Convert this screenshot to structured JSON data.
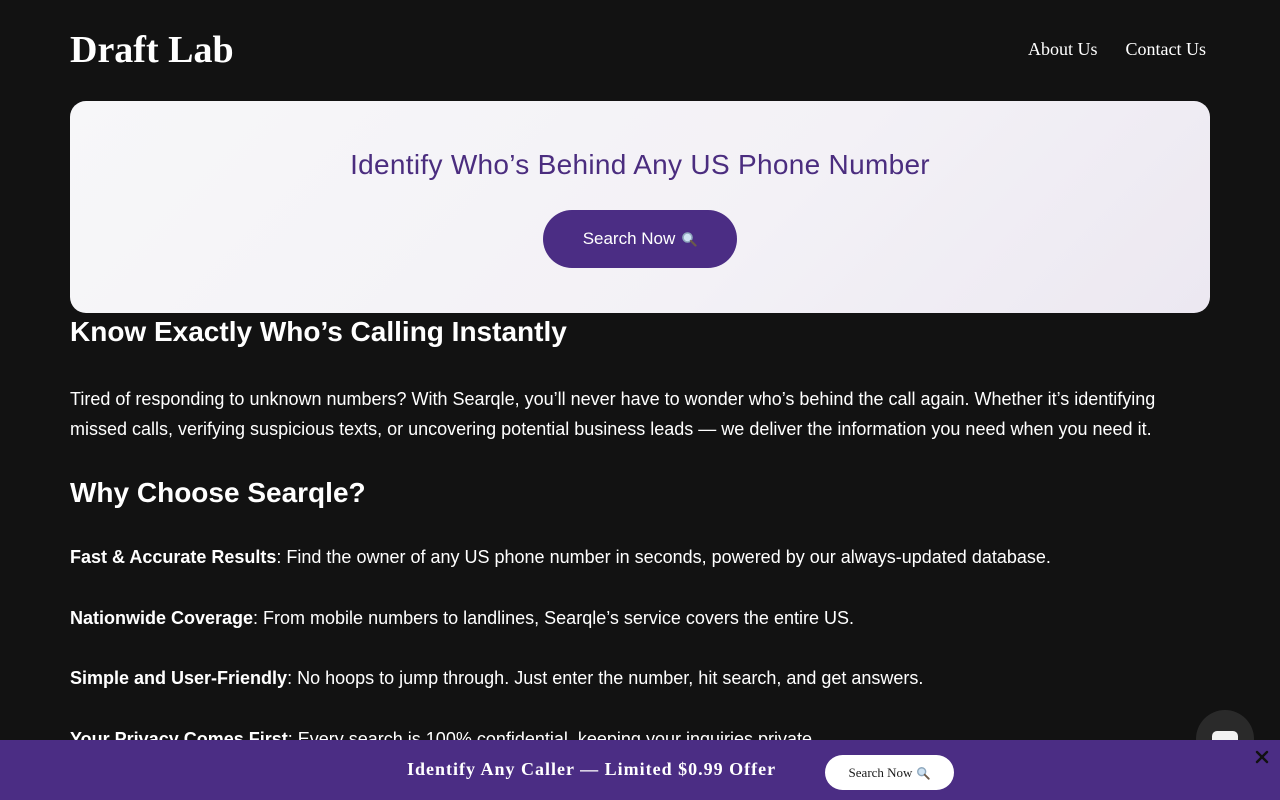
{
  "header": {
    "logo": "Draft Lab",
    "nav": [
      "About Us",
      "Contact Us"
    ]
  },
  "hero": {
    "title": "Identify Who’s Behind Any US Phone Number",
    "button_label": "Search Now",
    "button_icon": "magnifier-icon"
  },
  "content": {
    "heading": "Know Exactly Who’s Calling Instantly",
    "intro": "Tired of responding to unknown numbers? With Searqle, you’ll never have to wonder who’s behind the call again. Whether it’s identifying missed calls, verifying suspicious texts, or uncovering potential business leads — we deliver the information you need when you need it.",
    "why_heading": "Why Choose Searqle?",
    "features": [
      {
        "title": "Fast & Accurate Results",
        "text": ": Find the owner of any US phone number in seconds, powered by our always-updated database."
      },
      {
        "title": "Nationwide Coverage",
        "text": ": From mobile numbers to landlines, Searqle’s service covers the entire US."
      },
      {
        "title": "Simple and User-Friendly",
        "text": ": No hoops to jump through. Just enter the number, hit search, and get answers."
      },
      {
        "title": "Your Privacy Comes First",
        "text": ": Every search is 100% confidential, keeping your inquiries private."
      }
    ]
  },
  "bottom_bar": {
    "text": "Identify Any Caller — Limited $0.99 Offer",
    "button_label": "Search Now",
    "close_icon": "close-icon"
  },
  "colors": {
    "background": "#121212",
    "accent": "#4b2d84",
    "hero_title": "#4b2d7f"
  }
}
